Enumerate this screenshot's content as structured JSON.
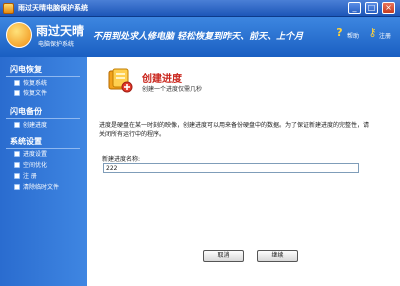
{
  "window": {
    "title": "雨过天晴电脑保护系统"
  },
  "header": {
    "product_name": "雨过天晴",
    "product_sub": "电脑保护系统",
    "slogan": "不用到处求人修电脑 轻松恢复到昨天、前天、上个月",
    "help_label": "帮助",
    "register_label": "注册"
  },
  "sidebar": {
    "sections": [
      {
        "title": "闪电恢复",
        "items": [
          {
            "label": "恢复系统"
          },
          {
            "label": "恢复文件"
          }
        ]
      },
      {
        "title": "闪电备份",
        "items": [
          {
            "label": "创建进度"
          }
        ]
      },
      {
        "title": "系统设置",
        "items": [
          {
            "label": "进度设置"
          },
          {
            "label": "空间优化"
          },
          {
            "label": "注 册"
          },
          {
            "label": "清除临时文件"
          }
        ]
      }
    ]
  },
  "main": {
    "task_title": "创建进度",
    "task_subtitle": "创建一个进度仅需几秒",
    "description": "进度是硬盘在某一时刻的映像，创建进度可以用来备份硬盘中的数据。为了保证新建进度的完整性，请关闭所有运行中的程序。",
    "field_label": "新建进度名称:",
    "field_value": "222",
    "cancel_label": "取消",
    "continue_label": "继续"
  }
}
